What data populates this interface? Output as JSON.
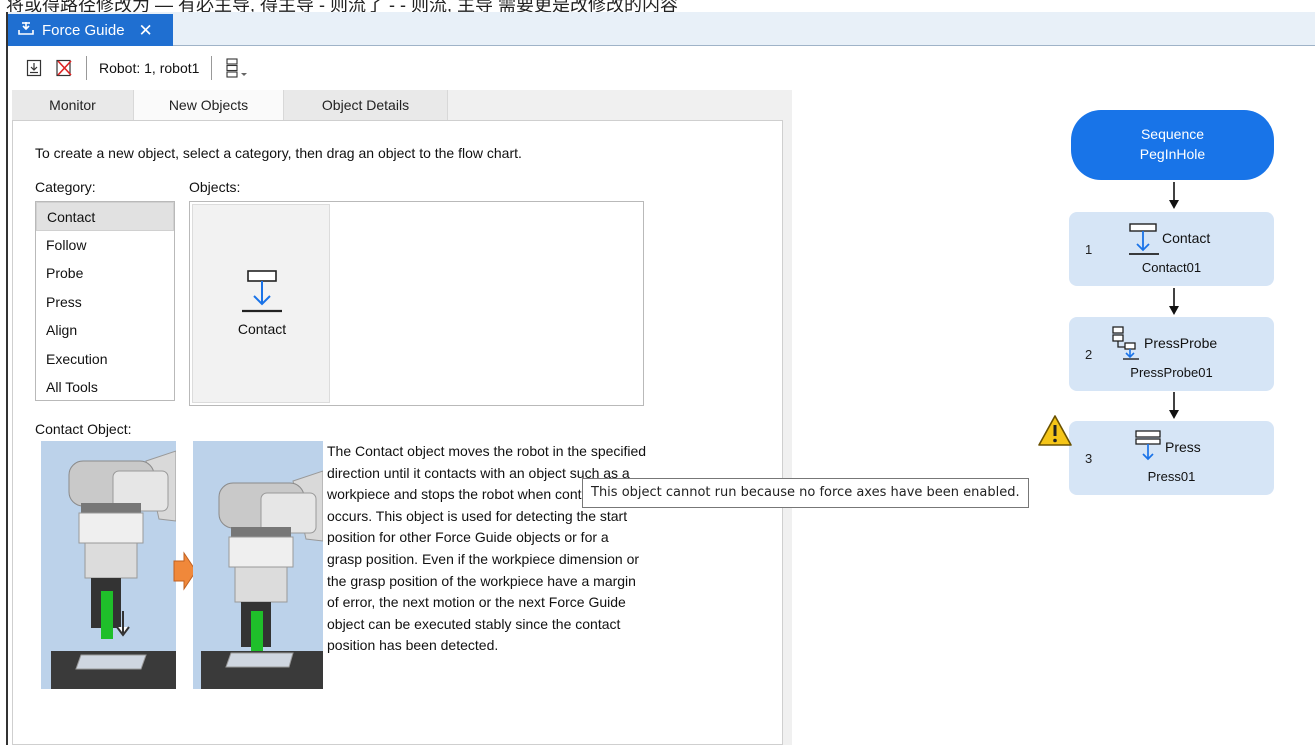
{
  "header_strip": "将或得路径修改为 — 有必主导, 得主导 - 则流了 - - 则流, 主导 需要更是改修改的内容",
  "tab": {
    "title": "Force Guide",
    "close": "✕"
  },
  "toolbar": {
    "robot_label": "Robot: 1, robot1"
  },
  "subtabs": [
    "Monitor",
    "New Objects",
    "Object Details"
  ],
  "instruction": "To create a new object, select a category, then drag an object to the flow chart.",
  "category_label": "Category:",
  "objects_label": "Objects:",
  "categories": [
    "Contact",
    "Follow",
    "Probe",
    "Press",
    "Align",
    "Execution",
    "All Tools"
  ],
  "selected_category": "Contact",
  "objects": [
    "Contact"
  ],
  "contact_object_label": "Contact Object:",
  "description": "The Contact object moves the robot in the specified direction until it contacts with an object such as a workpiece and stops the robot when contact occurs. This object is used for detecting the start position for other Force Guide objects or for a grasp position.  Even if the workpiece dimension or the grasp position of the workpiece have a margin of error, the next motion or the next Force Guide object can be executed stably since the contact position has been detected.",
  "tooltip": "This object cannot run because no force axes have been enabled.",
  "flowchart": {
    "sequence": {
      "line1": "Sequence",
      "line2": "PegInHole"
    },
    "nodes": [
      {
        "num": "1",
        "type": "Contact",
        "name": "Contact01",
        "icon": "contact-icon"
      },
      {
        "num": "2",
        "type": "PressProbe",
        "name": "PressProbe01",
        "icon": "pressprobe-icon"
      },
      {
        "num": "3",
        "type": "Press",
        "name": "Press01",
        "icon": "press-icon",
        "warning": true
      }
    ]
  },
  "colors": {
    "tab_blue": "#1f6fd1",
    "sequence_blue": "#1874e8",
    "node_fill": "#d6e5f6",
    "icon_blue": "#1a73e8",
    "warning_yellow": "#f5c518"
  }
}
